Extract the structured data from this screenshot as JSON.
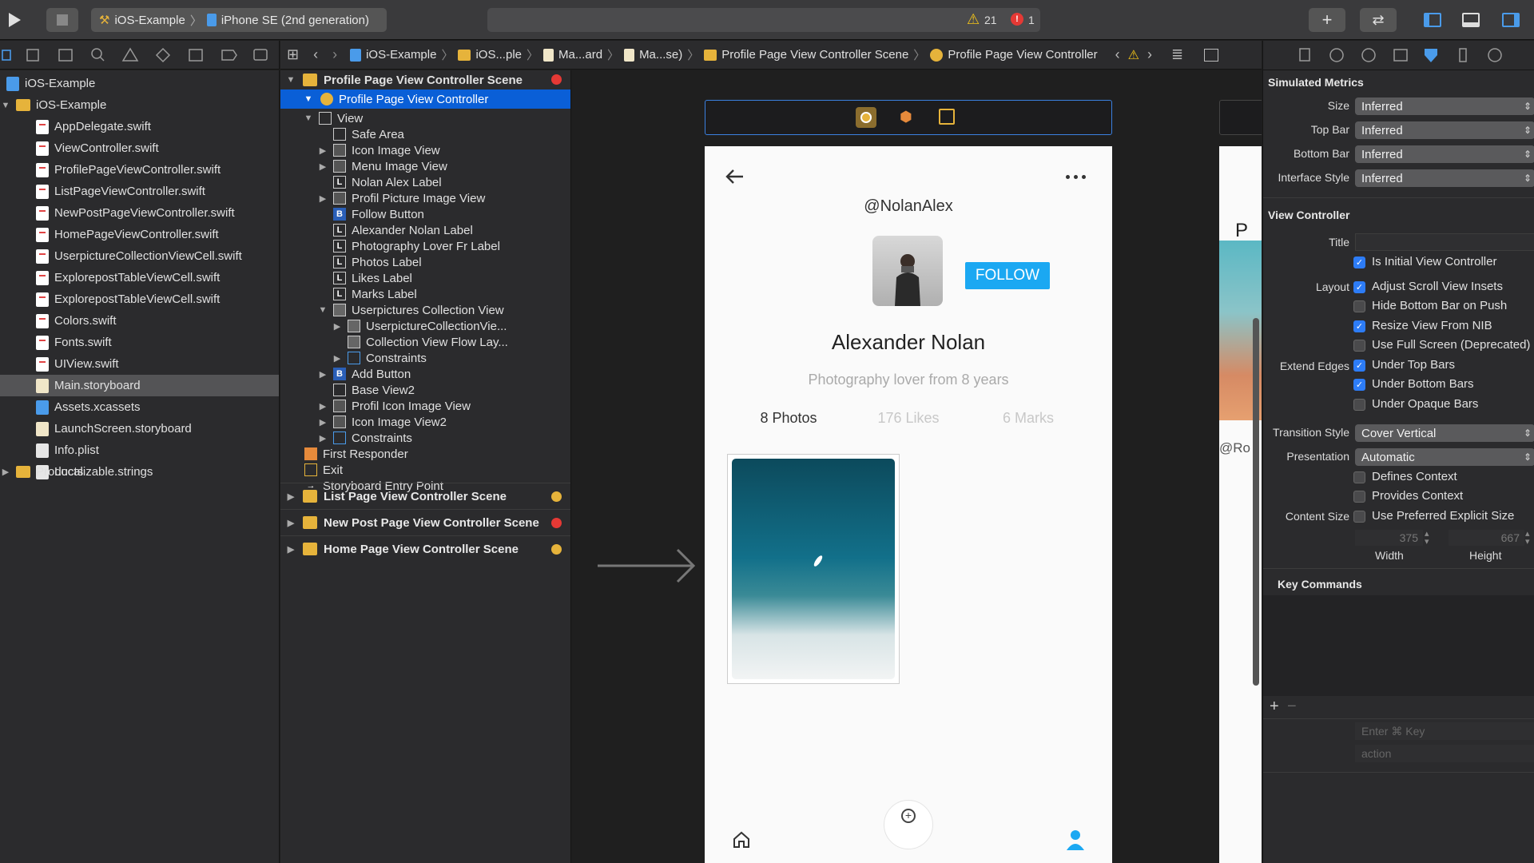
{
  "toolbar": {
    "scheme_project": "iOS-Example",
    "scheme_device": "iPhone SE (2nd generation)",
    "warnings": "21",
    "errors": "1"
  },
  "navigator": {
    "project": "iOS-Example",
    "group": "iOS-Example",
    "files": [
      "AppDelegate.swift",
      "ViewController.swift",
      "ProfilePageViewController.swift",
      "ListPageViewController.swift",
      "NewPostPageViewController.swift",
      "HomePageViewController.swift",
      "UserpictureCollectionViewCell.swift",
      "ExplorepostTableViewCell.swift",
      "ExplorepostTableViewCell.swift",
      "Colors.swift",
      "Fonts.swift",
      "UIView.swift",
      "Main.storyboard",
      "Assets.xcassets",
      "LaunchScreen.storyboard",
      "Info.plist",
      "Localizable.strings"
    ],
    "products": "Products"
  },
  "jumpbar": {
    "items": [
      "iOS-Example",
      "iOS...ple",
      "Ma...ard",
      "Ma...se)",
      "Profile Page View Controller Scene",
      "Profile Page View Controller"
    ]
  },
  "outline": {
    "scene_title": "Profile Page View Controller Scene",
    "controller": "Profile Page View Controller",
    "rows": [
      {
        "label": "View",
        "icon": ""
      },
      {
        "label": "Safe Area",
        "icon": ""
      },
      {
        "label": "Icon Image View",
        "icon": ""
      },
      {
        "label": "Menu Image View",
        "icon": ""
      },
      {
        "label": "Nolan Alex Label",
        "icon": "L"
      },
      {
        "label": "Profil Picture Image View",
        "icon": ""
      },
      {
        "label": "Follow Button",
        "icon": "B"
      },
      {
        "label": "Alexander Nolan Label",
        "icon": "L"
      },
      {
        "label": "Photography Lover Fr Label",
        "icon": "L"
      },
      {
        "label": "Photos Label",
        "icon": "L"
      },
      {
        "label": "Likes Label",
        "icon": "L"
      },
      {
        "label": "Marks Label",
        "icon": "L"
      },
      {
        "label": "Userpictures Collection View",
        "icon": ""
      },
      {
        "label": "UserpictureCollectionVie...",
        "icon": ""
      },
      {
        "label": "Collection View Flow Lay...",
        "icon": ""
      },
      {
        "label": "Constraints",
        "icon": ""
      },
      {
        "label": "Add Button",
        "icon": "B"
      },
      {
        "label": "Base View2",
        "icon": ""
      },
      {
        "label": "Profil Icon Image View",
        "icon": ""
      },
      {
        "label": "Icon Image View2",
        "icon": ""
      },
      {
        "label": "Constraints",
        "icon": ""
      },
      {
        "label": "First Responder",
        "icon": ""
      },
      {
        "label": "Exit",
        "icon": ""
      },
      {
        "label": "Storyboard Entry Point",
        "icon": ""
      }
    ],
    "scenes": [
      "List Page View Controller Scene",
      "New Post Page View Controller Scene",
      "Home Page View Controller Scene"
    ]
  },
  "phone": {
    "username": "@NolanAlex",
    "follow": "FOLLOW",
    "name": "Alexander Nolan",
    "bio": "Photography lover from 8 years",
    "photos": "8 Photos",
    "likes": "176 Likes",
    "marks": "6 Marks",
    "next_peek": "P",
    "next_peek2": "@Ro"
  },
  "inspector": {
    "sim_title": "Simulated Metrics",
    "size_label": "Size",
    "size": "Inferred",
    "topbar_label": "Top Bar",
    "topbar": "Inferred",
    "bottombar_label": "Bottom Bar",
    "bottombar": "Inferred",
    "style_label": "Interface Style",
    "style": "Inferred",
    "vc_title": "View Controller",
    "title_label": "Title",
    "initial": "Is Initial View Controller",
    "layout_label": "Layout",
    "adjust": "Adjust Scroll View Insets",
    "hidebottom": "Hide Bottom Bar on Push",
    "resize": "Resize View From NIB",
    "fullscreen": "Use Full Screen (Deprecated)",
    "extend_label": "Extend Edges",
    "undertop": "Under Top Bars",
    "underbottom": "Under Bottom Bars",
    "underopaque": "Under Opaque Bars",
    "transition_label": "Transition Style",
    "transition": "Cover Vertical",
    "presentation_label": "Presentation",
    "presentation": "Automatic",
    "defines": "Defines Context",
    "provides": "Provides Context",
    "contentsize_label": "Content Size",
    "preferred": "Use Preferred Explicit Size",
    "width_val": "375",
    "height_val": "667",
    "width_label": "Width",
    "height_label": "Height",
    "keycmd_title": "Key Commands",
    "key_placeholder": "Enter ⌘ Key",
    "action_placeholder": "action"
  }
}
